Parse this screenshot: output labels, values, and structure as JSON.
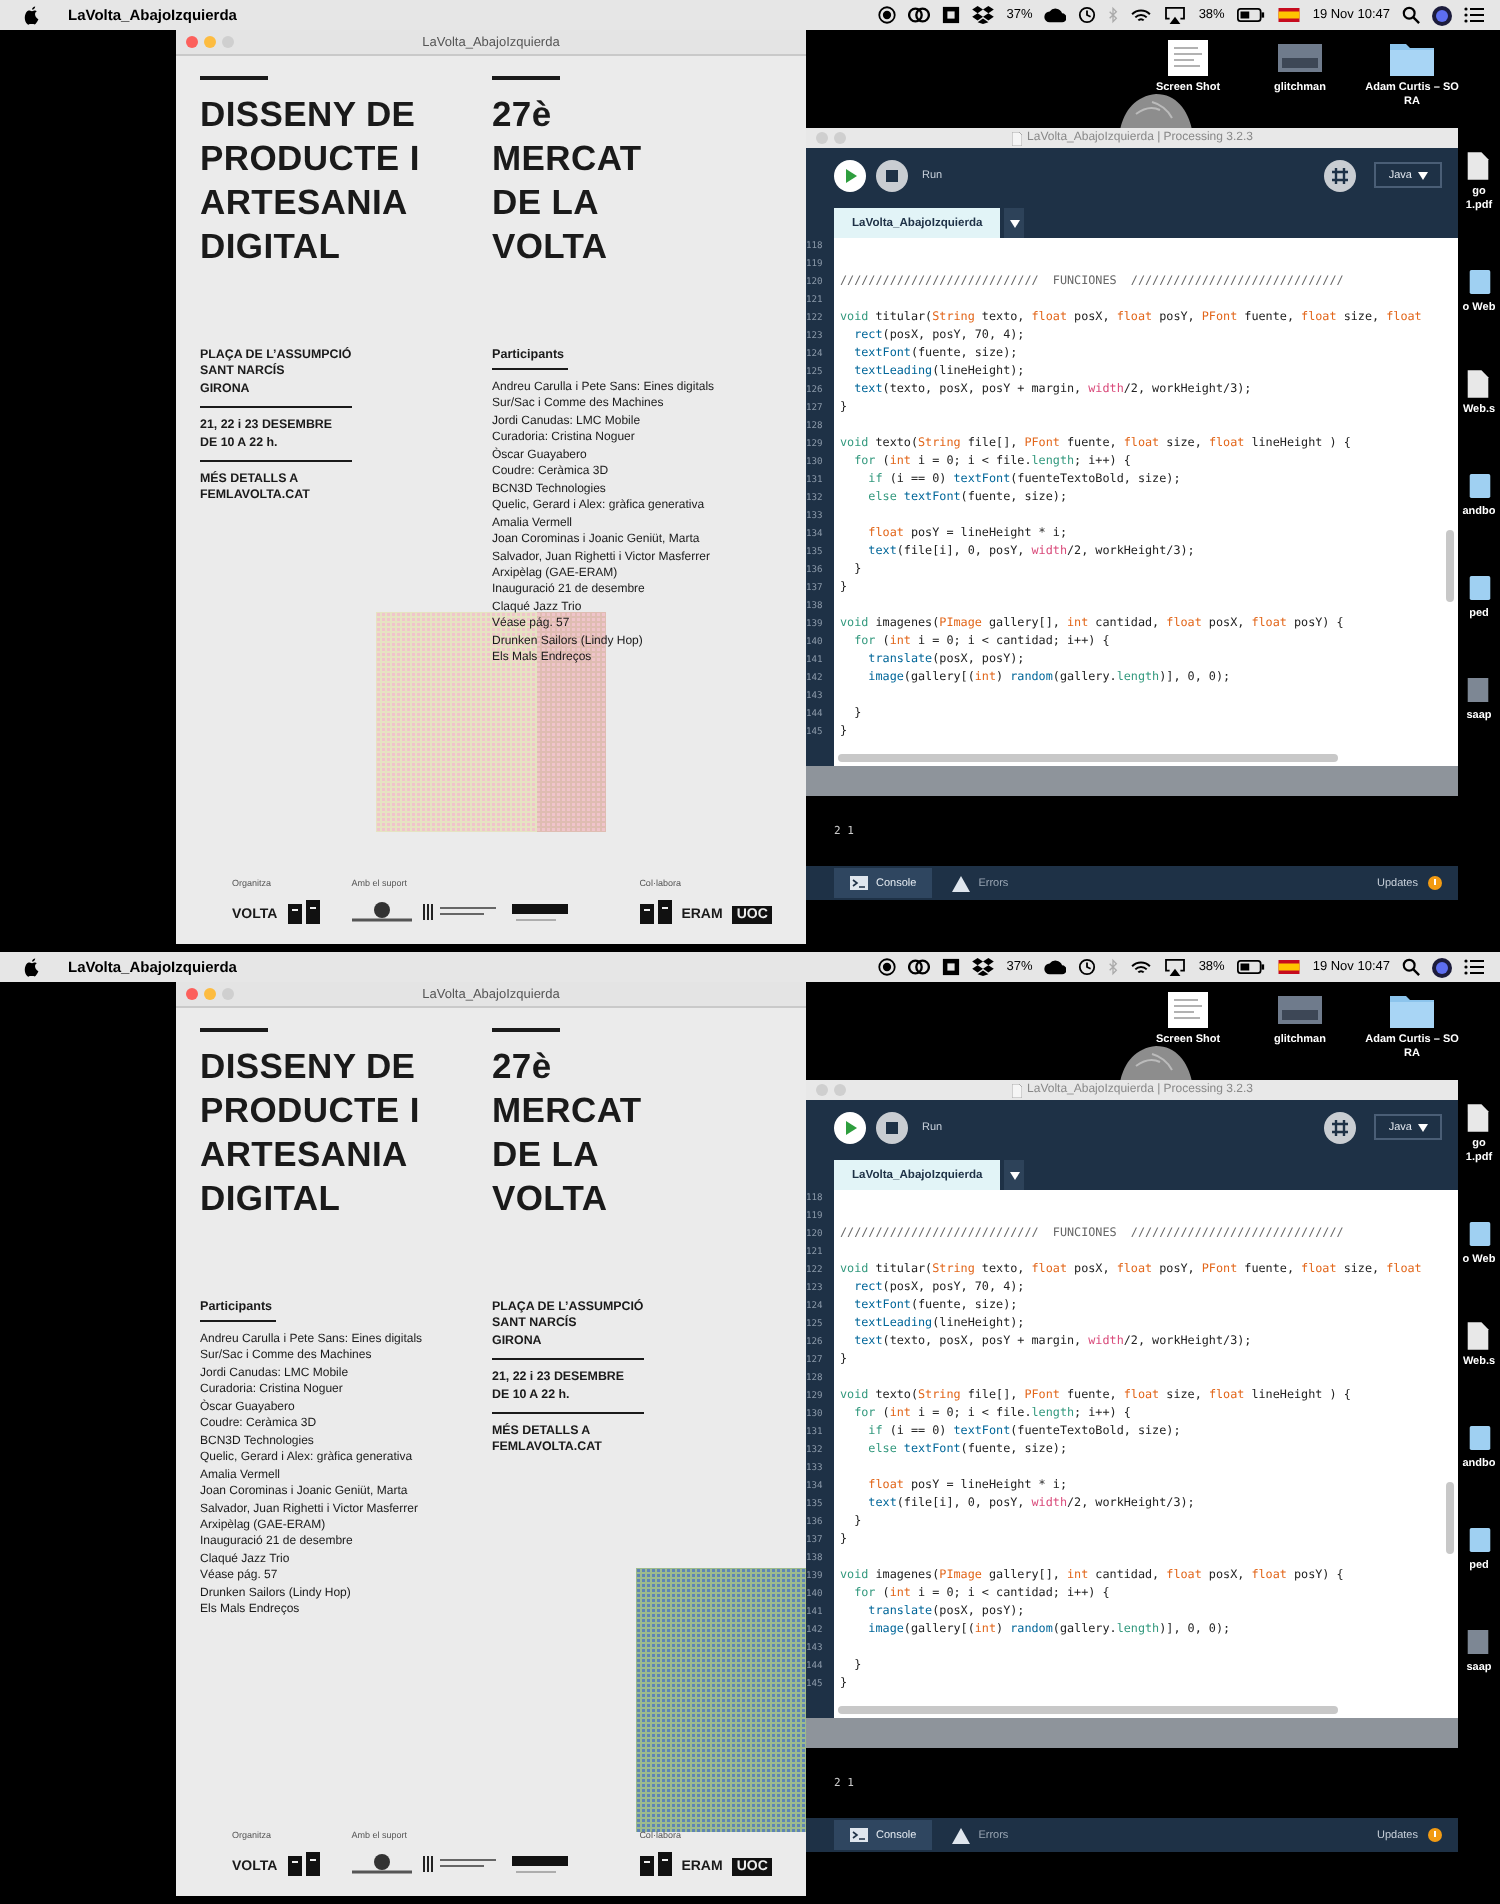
{
  "screens": [
    {
      "menubar": {
        "app_name": "LaVolta_AbajoIzquierda",
        "cpu_reading": "37%",
        "battery_reading": "38%",
        "clock": "19 Nov 10:47"
      },
      "desktop": {
        "top_icons": [
          {
            "kind": "document",
            "lines": [
              "Screen Shot"
            ]
          },
          {
            "kind": "photo",
            "lines": [
              "glitchman"
            ]
          },
          {
            "kind": "folder",
            "lines": [
              "Adam Curtis – SO",
              "RA"
            ]
          }
        ],
        "side_icons": [
          {
            "kind": "document",
            "lines": [
              "go",
              "1.pdf"
            ]
          },
          {
            "kind": "folder",
            "lines": [
              "o Web"
            ]
          },
          {
            "kind": "document",
            "lines": [
              "Web.s"
            ]
          },
          {
            "kind": "folder",
            "lines": [
              "andbo"
            ]
          },
          {
            "kind": "folder",
            "lines": [
              "ped"
            ]
          },
          {
            "kind": "photo",
            "lines": [
              "saap"
            ]
          }
        ]
      },
      "poster_window": {
        "title": "LaVolta_AbajoIzquierda",
        "poster": {
          "kind": "info-left",
          "title_left": [
            "DISSENY DE",
            "PRODUCTE I",
            "ARTESANIA",
            "DIGITAL"
          ],
          "title_right": [
            "27è",
            "MERCAT",
            "DE LA",
            "VOLTA"
          ],
          "info": [
            {
              "lines": [
                "PLAÇA DE L’ASSUMPCIÓ",
                "SANT NARCÍS",
                "GIRONA"
              ]
            },
            {
              "lines": [
                "21, 22 i 23 DESEMBRE",
                "DE 10 A 22 h."
              ]
            },
            {
              "lines": [
                "MÉS DETALLS A",
                "FEMLAVOLTA.CAT"
              ]
            }
          ],
          "participants": {
            "heading": "Participants",
            "items": [
              "Andreu Carulla i Pete Sans: Eines digitals",
              "Sur/Sac i Comme des Machines",
              "Jordi Canudas: LMC Mobile",
              "Curadoria: Cristina Noguer",
              "Òscar Guayabero",
              "Coudre: Ceràmica 3D",
              "BCN3D Technologies",
              "Quelic, Gerard i Alex: gràfica generativa",
              "Amalia Vermell",
              "Joan Corominas i Joanic Geniüt, Marta",
              "Salvador, Juan Righetti i Victor Masferrer",
              "Arxipèlag (GAE-ERAM)",
              "Inauguració 21 de desembre",
              "Claqué Jazz Trio",
              "Véase pág. 57",
              "Drunken Sailors (Lindy Hop)",
              "Els Mals Endreços"
            ]
          },
          "pattern": {
            "kind": "pink"
          },
          "footer": [
            {
              "heading": "Organitza",
              "logos": [
                {
                  "kind": "wordmark",
                  "text": "VOLTA"
                },
                {
                  "kind": "mark"
                }
              ]
            },
            {
              "heading": "Amb el suport",
              "logos": [
                {
                  "kind": "crest"
                },
                {
                  "kind": "stripes"
                },
                {
                  "kind": "bar"
                }
              ]
            },
            {
              "heading": "Col·labora",
              "logos": [
                {
                  "kind": "mark"
                },
                {
                  "kind": "wordmark",
                  "text": "ERAM"
                },
                {
                  "kind": "boxed",
                  "text": "UOC"
                }
              ]
            }
          ]
        }
      },
      "ide": {
        "title": "LaVolta_AbajoIzquierda | Processing 3.2.3",
        "run_label": "Run",
        "mode": "Java",
        "tabs": [
          {
            "label": "LaVolta_AbajoIzquierda",
            "selected": true
          }
        ],
        "lines": [
          {
            "n": "118"
          },
          {
            "n": "119"
          },
          {
            "n": "120",
            "segs": [
              {
                "kind": "comment",
                "text": "////////////////////////////  FUNCIONES  //////////////////////////////"
              }
            ]
          },
          {
            "n": "121"
          },
          {
            "n": "122",
            "segs": [
              {
                "kind": "keyword",
                "text": "void"
              },
              {
                "kind": "plain",
                "text": " titular("
              },
              {
                "kind": "type",
                "text": "String"
              },
              {
                "kind": "plain",
                "text": " texto, "
              },
              {
                "kind": "type",
                "text": "float"
              },
              {
                "kind": "plain",
                "text": " posX, "
              },
              {
                "kind": "type",
                "text": "float"
              },
              {
                "kind": "plain",
                "text": " posY, "
              },
              {
                "kind": "type",
                "text": "PFont"
              },
              {
                "kind": "plain",
                "text": " fuente, "
              },
              {
                "kind": "type",
                "text": "float"
              },
              {
                "kind": "plain",
                "text": " size, "
              },
              {
                "kind": "type",
                "text": "float"
              }
            ]
          },
          {
            "n": "123",
            "segs": [
              {
                "kind": "function",
                "text": "  rect"
              },
              {
                "kind": "plain",
                "text": "(posX, posY, 70, 4);"
              }
            ]
          },
          {
            "n": "124",
            "segs": [
              {
                "kind": "function",
                "text": "  textFont"
              },
              {
                "kind": "plain",
                "text": "(fuente, size);"
              }
            ]
          },
          {
            "n": "125",
            "segs": [
              {
                "kind": "function",
                "text": "  textLeading"
              },
              {
                "kind": "plain",
                "text": "(lineHeight);"
              }
            ]
          },
          {
            "n": "126",
            "segs": [
              {
                "kind": "function",
                "text": "  text"
              },
              {
                "kind": "plain",
                "text": "(texto, posX, posY + margin, "
              },
              {
                "kind": "variable",
                "text": "width"
              },
              {
                "kind": "plain",
                "text": "/2, workHeight/3);"
              }
            ]
          },
          {
            "n": "127",
            "segs": [
              {
                "kind": "plain",
                "text": "}"
              }
            ]
          },
          {
            "n": "128"
          },
          {
            "n": "129",
            "segs": [
              {
                "kind": "keyword",
                "text": "void"
              },
              {
                "kind": "plain",
                "text": " texto("
              },
              {
                "kind": "type",
                "text": "String"
              },
              {
                "kind": "plain",
                "text": " file[], "
              },
              {
                "kind": "type",
                "text": "PFont"
              },
              {
                "kind": "plain",
                "text": " fuente, "
              },
              {
                "kind": "type",
                "text": "float"
              },
              {
                "kind": "plain",
                "text": " size, "
              },
              {
                "kind": "type",
                "text": "float"
              },
              {
                "kind": "plain",
                "text": " lineHeight ) {"
              }
            ]
          },
          {
            "n": "130",
            "segs": [
              {
                "kind": "keyword",
                "text": "  for"
              },
              {
                "kind": "plain",
                "text": " ("
              },
              {
                "kind": "type",
                "text": "int"
              },
              {
                "kind": "plain",
                "text": " i = 0; i < file."
              },
              {
                "kind": "property",
                "text": "length"
              },
              {
                "kind": "plain",
                "text": "; i++) {"
              }
            ]
          },
          {
            "n": "131",
            "segs": [
              {
                "kind": "keyword",
                "text": "    if"
              },
              {
                "kind": "plain",
                "text": " (i == 0) "
              },
              {
                "kind": "function",
                "text": "textFont"
              },
              {
                "kind": "plain",
                "text": "(fuenteTextoBold, size);"
              }
            ]
          },
          {
            "n": "132",
            "segs": [
              {
                "kind": "keyword",
                "text": "    else"
              },
              {
                "kind": "function",
                "text": " textFont"
              },
              {
                "kind": "plain",
                "text": "(fuente, size);"
              }
            ]
          },
          {
            "n": "133"
          },
          {
            "n": "134",
            "segs": [
              {
                "kind": "type",
                "text": "    float"
              },
              {
                "kind": "plain",
                "text": " posY = lineHeight * i;"
              }
            ]
          },
          {
            "n": "135",
            "segs": [
              {
                "kind": "function",
                "text": "    text"
              },
              {
                "kind": "plain",
                "text": "(file[i], 0, posY, "
              },
              {
                "kind": "variable",
                "text": "width"
              },
              {
                "kind": "plain",
                "text": "/2, workHeight/3);"
              }
            ]
          },
          {
            "n": "136",
            "segs": [
              {
                "kind": "plain",
                "text": "  }"
              }
            ]
          },
          {
            "n": "137",
            "segs": [
              {
                "kind": "plain",
                "text": "}"
              }
            ]
          },
          {
            "n": "138"
          },
          {
            "n": "139",
            "segs": [
              {
                "kind": "keyword",
                "text": "void"
              },
              {
                "kind": "plain",
                "text": " imagenes("
              },
              {
                "kind": "type",
                "text": "PImage"
              },
              {
                "kind": "plain",
                "text": " gallery[], "
              },
              {
                "kind": "type",
                "text": "int"
              },
              {
                "kind": "plain",
                "text": " cantidad, "
              },
              {
                "kind": "type",
                "text": "float"
              },
              {
                "kind": "plain",
                "text": " posX, "
              },
              {
                "kind": "type",
                "text": "float"
              },
              {
                "kind": "plain",
                "text": " posY) {"
              }
            ]
          },
          {
            "n": "140",
            "segs": [
              {
                "kind": "keyword",
                "text": "  for"
              },
              {
                "kind": "plain",
                "text": " ("
              },
              {
                "kind": "type",
                "text": "int"
              },
              {
                "kind": "plain",
                "text": " i = 0; i < cantidad; i++) {"
              }
            ]
          },
          {
            "n": "141",
            "segs": [
              {
                "kind": "function",
                "text": "    translate"
              },
              {
                "kind": "plain",
                "text": "(posX, posY);"
              }
            ]
          },
          {
            "n": "142",
            "segs": [
              {
                "kind": "function",
                "text": "    image"
              },
              {
                "kind": "plain",
                "text": "(gallery[("
              },
              {
                "kind": "type",
                "text": "int"
              },
              {
                "kind": "plain",
                "text": ") "
              },
              {
                "kind": "function",
                "text": "random"
              },
              {
                "kind": "plain",
                "text": "(gallery."
              },
              {
                "kind": "property",
                "text": "length"
              },
              {
                "kind": "plain",
                "text": ")], 0, 0);"
              }
            ]
          },
          {
            "n": "143"
          },
          {
            "n": "144",
            "segs": [
              {
                "kind": "plain",
                "text": "  }"
              }
            ]
          },
          {
            "n": "145",
            "segs": [
              {
                "kind": "plain",
                "text": "}"
              }
            ]
          }
        ],
        "console_output": "2 1",
        "console_tabs": [
          {
            "kind": "console",
            "label": "Console",
            "selected": true
          },
          {
            "kind": "errors",
            "label": "Errors",
            "selected": false
          }
        ],
        "updates_label": "Updates"
      }
    },
    {
      "menubar": {
        "app_name": "LaVolta_AbajoIzquierda",
        "cpu_reading": "37%",
        "battery_reading": "38%",
        "clock": "19 Nov 10:47"
      },
      "desktop": {
        "top_icons": [
          {
            "kind": "document",
            "lines": [
              "Screen Shot"
            ]
          },
          {
            "kind": "photo",
            "lines": [
              "glitchman"
            ]
          },
          {
            "kind": "folder",
            "lines": [
              "Adam Curtis – SO",
              "RA"
            ]
          }
        ],
        "side_icons": [
          {
            "kind": "document",
            "lines": [
              "go",
              "1.pdf"
            ]
          },
          {
            "kind": "folder",
            "lines": [
              "o Web"
            ]
          },
          {
            "kind": "document",
            "lines": [
              "Web.s"
            ]
          },
          {
            "kind": "folder",
            "lines": [
              "andbo"
            ]
          },
          {
            "kind": "folder",
            "lines": [
              "ped"
            ]
          },
          {
            "kind": "photo",
            "lines": [
              "saap"
            ]
          }
        ]
      },
      "poster_window": {
        "title": "LaVolta_AbajoIzquierda",
        "poster": {
          "kind": "participants-left",
          "title_left": [
            "DISSENY DE",
            "PRODUCTE I",
            "ARTESANIA",
            "DIGITAL"
          ],
          "title_right": [
            "27è",
            "MERCAT",
            "DE LA",
            "VOLTA"
          ],
          "info": [
            {
              "lines": [
                "PLAÇA DE L’ASSUMPCIÓ",
                "SANT NARCÍS",
                "GIRONA"
              ]
            },
            {
              "lines": [
                "21, 22 i 23 DESEMBRE",
                "DE 10 A 22 h."
              ]
            },
            {
              "lines": [
                "MÉS DETALLS A",
                "FEMLAVOLTA.CAT"
              ]
            }
          ],
          "participants": {
            "heading": "Participants",
            "items": [
              "Andreu Carulla i Pete Sans: Eines digitals",
              "Sur/Sac i Comme des Machines",
              "Jordi Canudas: LMC Mobile",
              "Curadoria: Cristina Noguer",
              "Òscar Guayabero",
              "Coudre: Ceràmica 3D",
              "BCN3D Technologies",
              "Quelic, Gerard i Alex: gràfica generativa",
              "Amalia Vermell",
              "Joan Corominas i Joanic Geniüt, Marta",
              "Salvador, Juan Righetti i Victor Masferrer",
              "Arxipèlag (GAE-ERAM)",
              "Inauguració 21 de desembre",
              "Claqué Jazz Trio",
              "Véase pág. 57",
              "Drunken Sailors (Lindy Hop)",
              "Els Mals Endreços"
            ]
          },
          "pattern": {
            "kind": "green"
          },
          "footer": [
            {
              "heading": "Organitza",
              "logos": [
                {
                  "kind": "wordmark",
                  "text": "VOLTA"
                },
                {
                  "kind": "mark"
                }
              ]
            },
            {
              "heading": "Amb el suport",
              "logos": [
                {
                  "kind": "crest"
                },
                {
                  "kind": "stripes"
                },
                {
                  "kind": "bar"
                }
              ]
            },
            {
              "heading": "Col·labora",
              "logos": [
                {
                  "kind": "mark"
                },
                {
                  "kind": "wordmark",
                  "text": "ERAM"
                },
                {
                  "kind": "boxed",
                  "text": "UOC"
                }
              ]
            }
          ]
        }
      },
      "ide": {
        "title": "LaVolta_AbajoIzquierda | Processing 3.2.3",
        "run_label": "Run",
        "mode": "Java",
        "tabs": [
          {
            "label": "LaVolta_AbajoIzquierda",
            "selected": true
          }
        ],
        "lines": [
          {
            "n": "118"
          },
          {
            "n": "119"
          },
          {
            "n": "120",
            "segs": [
              {
                "kind": "comment",
                "text": "////////////////////////////  FUNCIONES  //////////////////////////////"
              }
            ]
          },
          {
            "n": "121"
          },
          {
            "n": "122",
            "segs": [
              {
                "kind": "keyword",
                "text": "void"
              },
              {
                "kind": "plain",
                "text": " titular("
              },
              {
                "kind": "type",
                "text": "String"
              },
              {
                "kind": "plain",
                "text": " texto, "
              },
              {
                "kind": "type",
                "text": "float"
              },
              {
                "kind": "plain",
                "text": " posX, "
              },
              {
                "kind": "type",
                "text": "float"
              },
              {
                "kind": "plain",
                "text": " posY, "
              },
              {
                "kind": "type",
                "text": "PFont"
              },
              {
                "kind": "plain",
                "text": " fuente, "
              },
              {
                "kind": "type",
                "text": "float"
              },
              {
                "kind": "plain",
                "text": " size, "
              },
              {
                "kind": "type",
                "text": "float"
              }
            ]
          },
          {
            "n": "123",
            "segs": [
              {
                "kind": "function",
                "text": "  rect"
              },
              {
                "kind": "plain",
                "text": "(posX, posY, 70, 4);"
              }
            ]
          },
          {
            "n": "124",
            "segs": [
              {
                "kind": "function",
                "text": "  textFont"
              },
              {
                "kind": "plain",
                "text": "(fuente, size);"
              }
            ]
          },
          {
            "n": "125",
            "segs": [
              {
                "kind": "function",
                "text": "  textLeading"
              },
              {
                "kind": "plain",
                "text": "(lineHeight);"
              }
            ]
          },
          {
            "n": "126",
            "segs": [
              {
                "kind": "function",
                "text": "  text"
              },
              {
                "kind": "plain",
                "text": "(texto, posX, posY + margin, "
              },
              {
                "kind": "variable",
                "text": "width"
              },
              {
                "kind": "plain",
                "text": "/2, workHeight/3);"
              }
            ]
          },
          {
            "n": "127",
            "segs": [
              {
                "kind": "plain",
                "text": "}"
              }
            ]
          },
          {
            "n": "128"
          },
          {
            "n": "129",
            "segs": [
              {
                "kind": "keyword",
                "text": "void"
              },
              {
                "kind": "plain",
                "text": " texto("
              },
              {
                "kind": "type",
                "text": "String"
              },
              {
                "kind": "plain",
                "text": " file[], "
              },
              {
                "kind": "type",
                "text": "PFont"
              },
              {
                "kind": "plain",
                "text": " fuente, "
              },
              {
                "kind": "type",
                "text": "float"
              },
              {
                "kind": "plain",
                "text": " size, "
              },
              {
                "kind": "type",
                "text": "float"
              },
              {
                "kind": "plain",
                "text": " lineHeight ) {"
              }
            ]
          },
          {
            "n": "130",
            "segs": [
              {
                "kind": "keyword",
                "text": "  for"
              },
              {
                "kind": "plain",
                "text": " ("
              },
              {
                "kind": "type",
                "text": "int"
              },
              {
                "kind": "plain",
                "text": " i = 0; i < file."
              },
              {
                "kind": "property",
                "text": "length"
              },
              {
                "kind": "plain",
                "text": "; i++) {"
              }
            ]
          },
          {
            "n": "131",
            "segs": [
              {
                "kind": "keyword",
                "text": "    if"
              },
              {
                "kind": "plain",
                "text": " (i == 0) "
              },
              {
                "kind": "function",
                "text": "textFont"
              },
              {
                "kind": "plain",
                "text": "(fuenteTextoBold, size);"
              }
            ]
          },
          {
            "n": "132",
            "segs": [
              {
                "kind": "keyword",
                "text": "    else"
              },
              {
                "kind": "function",
                "text": " textFont"
              },
              {
                "kind": "plain",
                "text": "(fuente, size);"
              }
            ]
          },
          {
            "n": "133"
          },
          {
            "n": "134",
            "segs": [
              {
                "kind": "type",
                "text": "    float"
              },
              {
                "kind": "plain",
                "text": " posY = lineHeight * i;"
              }
            ]
          },
          {
            "n": "135",
            "segs": [
              {
                "kind": "function",
                "text": "    text"
              },
              {
                "kind": "plain",
                "text": "(file[i], 0, posY, "
              },
              {
                "kind": "variable",
                "text": "width"
              },
              {
                "kind": "plain",
                "text": "/2, workHeight/3);"
              }
            ]
          },
          {
            "n": "136",
            "segs": [
              {
                "kind": "plain",
                "text": "  }"
              }
            ]
          },
          {
            "n": "137",
            "segs": [
              {
                "kind": "plain",
                "text": "}"
              }
            ]
          },
          {
            "n": "138"
          },
          {
            "n": "139",
            "segs": [
              {
                "kind": "keyword",
                "text": "void"
              },
              {
                "kind": "plain",
                "text": " imagenes("
              },
              {
                "kind": "type",
                "text": "PImage"
              },
              {
                "kind": "plain",
                "text": " gallery[], "
              },
              {
                "kind": "type",
                "text": "int"
              },
              {
                "kind": "plain",
                "text": " cantidad, "
              },
              {
                "kind": "type",
                "text": "float"
              },
              {
                "kind": "plain",
                "text": " posX, "
              },
              {
                "kind": "type",
                "text": "float"
              },
              {
                "kind": "plain",
                "text": " posY) {"
              }
            ]
          },
          {
            "n": "140",
            "segs": [
              {
                "kind": "keyword",
                "text": "  for"
              },
              {
                "kind": "plain",
                "text": " ("
              },
              {
                "kind": "type",
                "text": "int"
              },
              {
                "kind": "plain",
                "text": " i = 0; i < cantidad; i++) {"
              }
            ]
          },
          {
            "n": "141",
            "segs": [
              {
                "kind": "function",
                "text": "    translate"
              },
              {
                "kind": "plain",
                "text": "(posX, posY);"
              }
            ]
          },
          {
            "n": "142",
            "segs": [
              {
                "kind": "function",
                "text": "    image"
              },
              {
                "kind": "plain",
                "text": "(gallery[("
              },
              {
                "kind": "type",
                "text": "int"
              },
              {
                "kind": "plain",
                "text": ") "
              },
              {
                "kind": "function",
                "text": "random"
              },
              {
                "kind": "plain",
                "text": "(gallery."
              },
              {
                "kind": "property",
                "text": "length"
              },
              {
                "kind": "plain",
                "text": ")], 0, 0);"
              }
            ]
          },
          {
            "n": "143"
          },
          {
            "n": "144",
            "segs": [
              {
                "kind": "plain",
                "text": "  }"
              }
            ]
          },
          {
            "n": "145",
            "segs": [
              {
                "kind": "plain",
                "text": "}"
              }
            ]
          }
        ],
        "console_output": "2 1",
        "console_tabs": [
          {
            "kind": "console",
            "label": "Console",
            "selected": true
          },
          {
            "kind": "errors",
            "label": "Errors",
            "selected": false
          }
        ],
        "updates_label": "Updates"
      }
    }
  ]
}
